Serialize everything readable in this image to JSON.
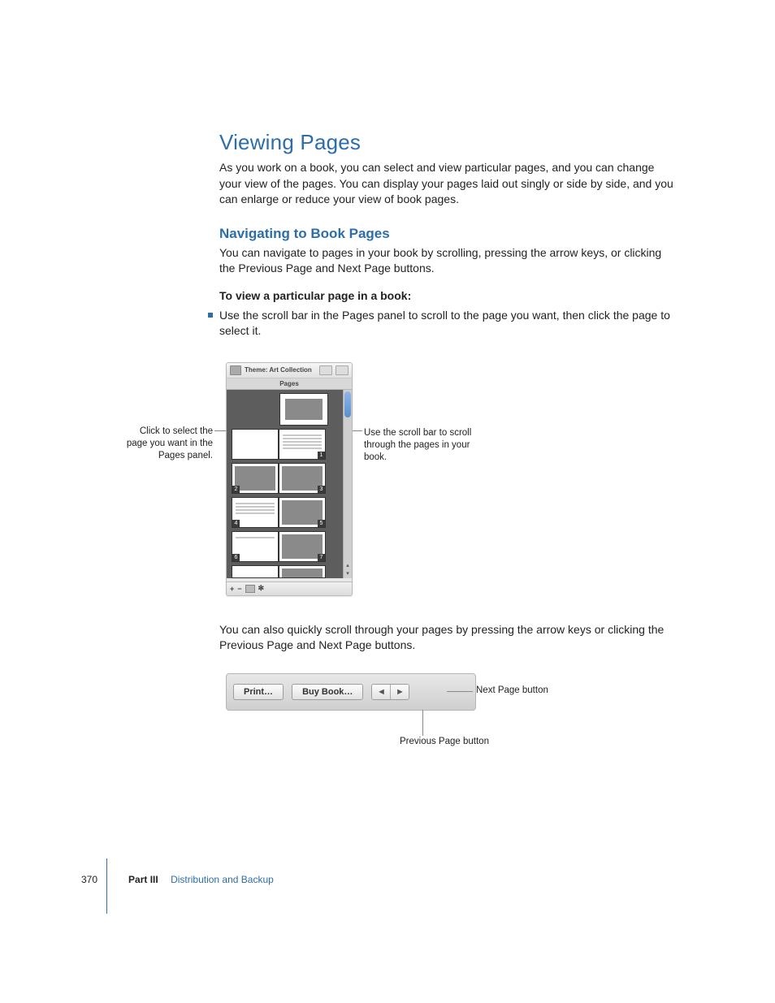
{
  "heading": "Viewing Pages",
  "intro": "As you work on a book, you can select and view particular pages, and you can change your view of the pages. You can display your pages laid out singly or side by side, and you can enlarge or reduce your view of book pages.",
  "subheading": "Navigating to Book Pages",
  "sub_intro": "You can navigate to pages in your book by scrolling, pressing the arrow keys, or clicking the Previous Page and Next Page buttons.",
  "task_lead": "To view a particular page in a book:",
  "bullet": "Use the scroll bar in the Pages panel to scroll to the page you want, then click the page to select it.",
  "callout_left": "Click to select the page you want in the Pages panel.",
  "callout_right": "Use the scroll bar to scroll through the pages in your book.",
  "panel": {
    "theme_label": "Theme: Art Collection",
    "tab_label": "Pages",
    "page_numbers": [
      "1",
      "2",
      "3",
      "4",
      "5",
      "6",
      "7"
    ],
    "add_glyph": "+",
    "remove_glyph": "−",
    "gear_glyph": "✻"
  },
  "para2": "You can also quickly scroll through your pages by pressing the arrow keys or clicking the Previous Page and Next Page buttons.",
  "toolbar": {
    "print": "Print…",
    "buy": "Buy Book…",
    "prev_glyph": "◄",
    "next_glyph": "►"
  },
  "caption_next": "Next Page button",
  "caption_prev": "Previous Page button",
  "footer": {
    "page": "370",
    "part": "Part III",
    "title": "Distribution and Backup"
  }
}
